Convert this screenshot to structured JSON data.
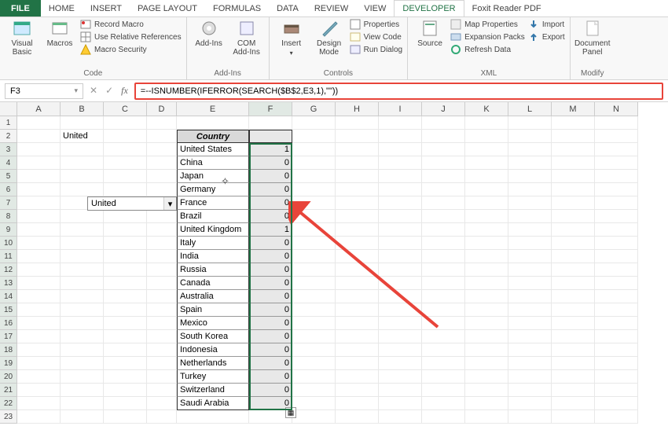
{
  "tabs": {
    "file": "FILE",
    "items": [
      "HOME",
      "INSERT",
      "PAGE LAYOUT",
      "FORMULAS",
      "DATA",
      "REVIEW",
      "VIEW",
      "DEVELOPER",
      "Foxit Reader PDF"
    ],
    "active_index": 7
  },
  "ribbon": {
    "code": {
      "visual_basic": "Visual\nBasic",
      "macros": "Macros",
      "record": "Record Macro",
      "references": "Use Relative References",
      "security": "Macro Security",
      "label": "Code"
    },
    "addins": {
      "addins": "Add-Ins",
      "com": "COM\nAdd-Ins",
      "label": "Add-Ins"
    },
    "controls": {
      "insert": "Insert",
      "design": "Design\nMode",
      "properties": "Properties",
      "viewcode": "View Code",
      "rundialog": "Run Dialog",
      "label": "Controls"
    },
    "xml": {
      "source": "Source",
      "mapprops": "Map Properties",
      "expansion": "Expansion Packs",
      "refresh": "Refresh Data",
      "import": "Import",
      "export": "Export",
      "label": "XML"
    },
    "modify": {
      "docpanel": "Document\nPanel",
      "label": "Modify"
    }
  },
  "formula_bar": {
    "name_box": "F3",
    "formula": "=--ISNUMBER(IFERROR(SEARCH($B$2,E3,1),\"\"))"
  },
  "columns": [
    "A",
    "B",
    "C",
    "D",
    "E",
    "F",
    "G",
    "H",
    "I",
    "J",
    "K",
    "L",
    "M",
    "N"
  ],
  "row_labels": [
    "1",
    "2",
    "3",
    "4",
    "5",
    "6",
    "7",
    "8",
    "9",
    "10",
    "11",
    "12",
    "13",
    "14",
    "15",
    "16",
    "17",
    "18",
    "19",
    "20",
    "21",
    "22",
    "23"
  ],
  "sheet": {
    "b2": "United",
    "dropdown_value": "United",
    "header": "Country",
    "data": [
      {
        "country": "United States",
        "val": "1"
      },
      {
        "country": "China",
        "val": "0"
      },
      {
        "country": "Japan",
        "val": "0"
      },
      {
        "country": "Germany",
        "val": "0"
      },
      {
        "country": "France",
        "val": "0"
      },
      {
        "country": "Brazil",
        "val": "0"
      },
      {
        "country": "United Kingdom",
        "val": "1"
      },
      {
        "country": "Italy",
        "val": "0"
      },
      {
        "country": "India",
        "val": "0"
      },
      {
        "country": "Russia",
        "val": "0"
      },
      {
        "country": "Canada",
        "val": "0"
      },
      {
        "country": "Australia",
        "val": "0"
      },
      {
        "country": "Spain",
        "val": "0"
      },
      {
        "country": "Mexico",
        "val": "0"
      },
      {
        "country": "South Korea",
        "val": "0"
      },
      {
        "country": "Indonesia",
        "val": "0"
      },
      {
        "country": "Netherlands",
        "val": "0"
      },
      {
        "country": "Turkey",
        "val": "0"
      },
      {
        "country": "Switzerland",
        "val": "0"
      },
      {
        "country": "Saudi Arabia",
        "val": "0"
      }
    ]
  }
}
